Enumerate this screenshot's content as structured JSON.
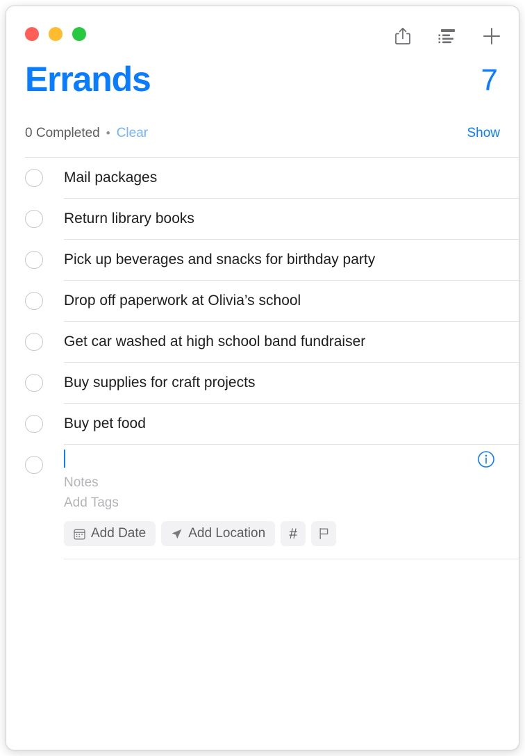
{
  "window": {
    "traffic_lights": [
      {
        "name": "close",
        "color": "#ff5f57"
      },
      {
        "name": "minimize",
        "color": "#febc2e"
      },
      {
        "name": "maximize",
        "color": "#28c840"
      }
    ]
  },
  "toolbar": {
    "share_icon": "share-icon",
    "list_options_icon": "list-options-icon",
    "add_icon": "plus-icon"
  },
  "header": {
    "title": "Errands",
    "count": "7",
    "accent_color": "#0a7cff"
  },
  "completed_bar": {
    "completed_text": "0 Completed",
    "separator_dot": "•",
    "clear_label": "Clear",
    "clear_color": "#74b2ff",
    "show_label": "Show",
    "show_color": "#0a7cff"
  },
  "reminders": [
    {
      "title": "Mail packages",
      "completed": false
    },
    {
      "title": "Return library books",
      "completed": false
    },
    {
      "title": "Pick up beverages and snacks for birthday party",
      "completed": false
    },
    {
      "title": "Drop off paperwork at Olivia’s school",
      "completed": false
    },
    {
      "title": "Get car washed at high school band fundraiser",
      "completed": false
    },
    {
      "title": "Buy supplies for craft projects",
      "completed": false
    },
    {
      "title": "Buy pet food",
      "completed": false
    }
  ],
  "editing_row": {
    "title_value": "",
    "notes_placeholder": "Notes",
    "tags_placeholder": "Add Tags",
    "info_icon": "info-circle-icon",
    "cursor_color": "#0a7cff",
    "actions": [
      {
        "name": "add-date",
        "label": "Add Date",
        "icon": "calendar-icon"
      },
      {
        "name": "add-location",
        "label": "Add Location",
        "icon": "location-arrow-icon"
      },
      {
        "name": "add-tag",
        "label": "#",
        "icon": "hash-icon"
      },
      {
        "name": "set-flag",
        "label": "",
        "icon": "flag-icon"
      }
    ]
  }
}
